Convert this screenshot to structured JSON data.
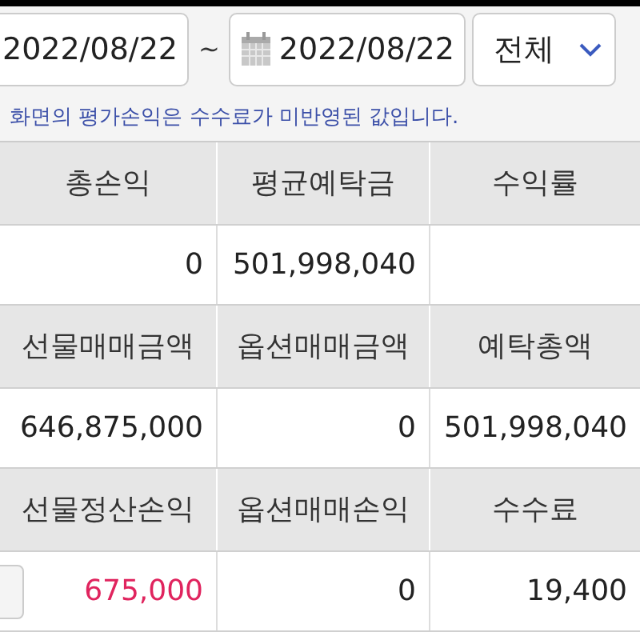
{
  "filter": {
    "start_date": "2022/08/22",
    "separator": "~",
    "end_date": "2022/08/22",
    "dropdown": "전체"
  },
  "notice": "화면의 평가손익은 수수료가 미반영된 값입니다.",
  "table": {
    "groups": [
      {
        "headers": [
          "총손익",
          "평균예탁금",
          "수익률"
        ],
        "values": {
          "column_1": {
            "text": "0",
            "color": "#222222"
          },
          "column_2": {
            "text": "501,998,040",
            "color": "#222222"
          }
        }
      },
      {
        "headers": [
          "선물매매금액",
          "옵션매매금액",
          "예탁총액"
        ],
        "values": {
          "column_1": {
            "text": "646,875,000",
            "color": "#222222"
          },
          "column_2": {
            "text": "0",
            "color": "#222222"
          },
          "column_3": {
            "text": "501,998,040",
            "color": "#222222"
          }
        }
      },
      {
        "headers": [
          "선물정산손익",
          "옵션매매손익",
          "수수료"
        ],
        "values": {
          "column_1": {
            "text": "675,000",
            "color": "#e0245e"
          },
          "column_2": {
            "text": "0",
            "color": "#222222"
          },
          "column_3": {
            "text": "19,400",
            "color": "#222222"
          }
        }
      }
    ]
  }
}
